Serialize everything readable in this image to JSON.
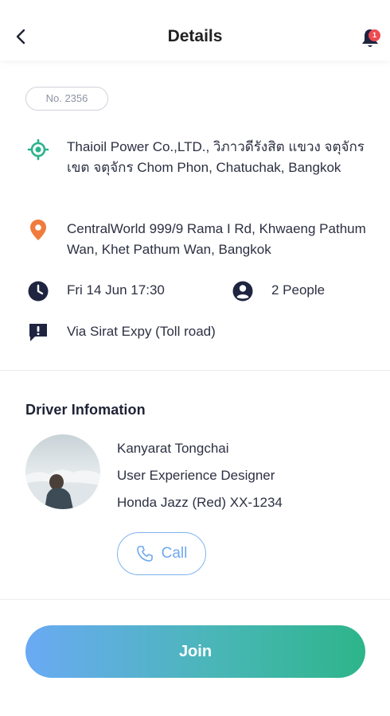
{
  "header": {
    "title": "Details",
    "notification_count": "1"
  },
  "order": {
    "number": "No. 2356"
  },
  "trip": {
    "pickup": "Thaioil Power Co.,LTD., วิภาวดีรังสิต แขวง จตุจักร เขต จตุจักร Chom Phon, Chatuchak, Bangkok",
    "dropoff": "CentralWorld 999/9 Rama I Rd, Khwaeng Pathum Wan, Khet Pathum Wan, Bangkok",
    "datetime": "Fri 14 Jun 17:30",
    "people": "2 People",
    "note": "Via Sirat Expy (Toll road)"
  },
  "driver": {
    "section_title": "Driver Infomation",
    "name": "Kanyarat Tongchai",
    "job": "User Experience Designer",
    "car": "Honda Jazz (Red) XX-1234",
    "call_label": "Call"
  },
  "actions": {
    "join_label": "Join"
  },
  "colors": {
    "pickup_icon": "#2bb38c",
    "dropoff_icon": "#f07b3c",
    "dark_icon": "#1f2440",
    "badge": "#ef4a52",
    "call_accent": "#6fa8ee",
    "join_gradient_start": "#6aaaf4",
    "join_gradient_end": "#2db58a"
  },
  "icons": {
    "back": "chevron-left-icon",
    "bell": "bell-icon",
    "pickup": "target-location-icon",
    "dropoff": "map-pin-icon",
    "time": "clock-icon",
    "people": "user-circle-icon",
    "note": "message-alert-icon",
    "call": "phone-icon"
  }
}
